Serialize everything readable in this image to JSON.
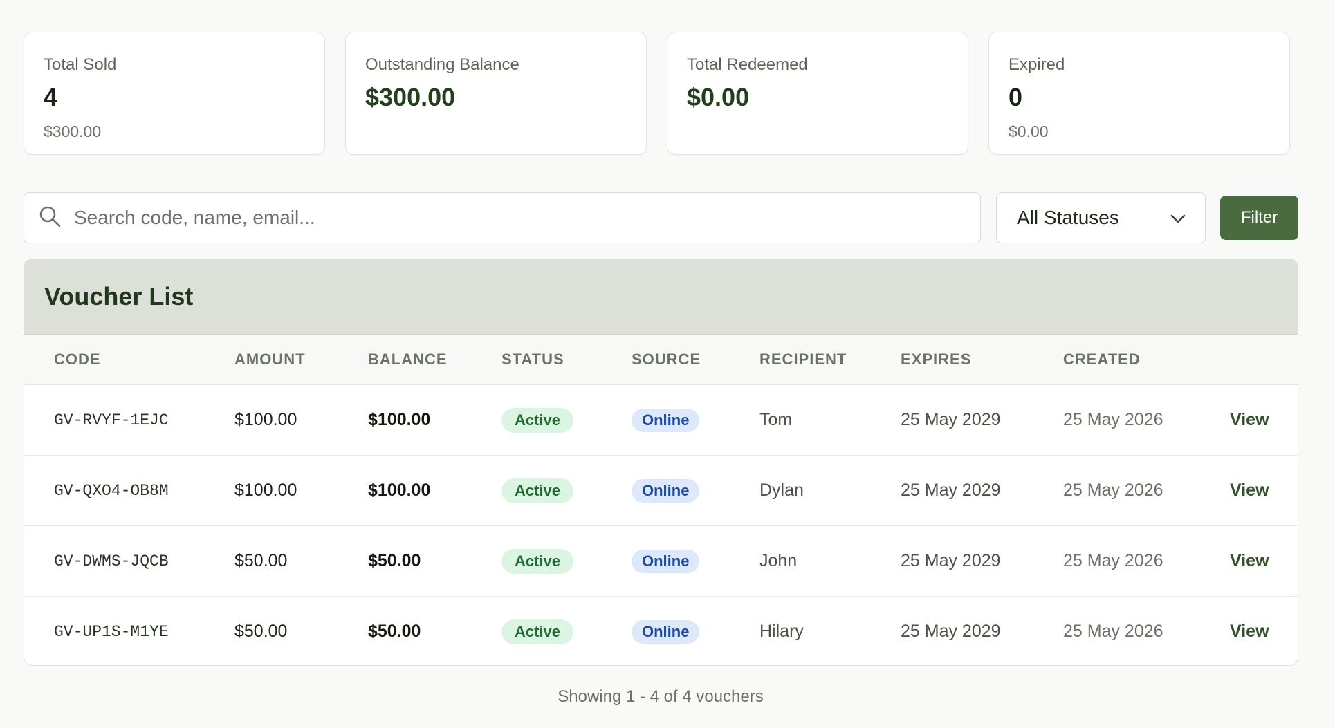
{
  "stats": [
    {
      "label": "Total Sold",
      "value": "4",
      "sub": "$300.00"
    },
    {
      "label": "Outstanding Balance",
      "value": "$300.00",
      "sub": ""
    },
    {
      "label": "Total Redeemed",
      "value": "$0.00",
      "sub": ""
    },
    {
      "label": "Expired",
      "value": "0",
      "sub": "$0.00"
    }
  ],
  "search": {
    "placeholder": "Search code, name, email...",
    "value": ""
  },
  "status_filter": {
    "selected": "All Statuses"
  },
  "filter_button": {
    "label": "Filter"
  },
  "panel": {
    "title": "Voucher List"
  },
  "table": {
    "columns": [
      "CODE",
      "AMOUNT",
      "BALANCE",
      "STATUS",
      "SOURCE",
      "RECIPIENT",
      "EXPIRES",
      "CREATED"
    ],
    "rows": [
      {
        "code": "GV-RVYF-1EJC",
        "amount": "$100.00",
        "balance": "$100.00",
        "status": "Active",
        "source": "Online",
        "recipient": "Tom",
        "expires": "25 May 2029",
        "created": "25 May 2026",
        "action": "View"
      },
      {
        "code": "GV-QXO4-OB8M",
        "amount": "$100.00",
        "balance": "$100.00",
        "status": "Active",
        "source": "Online",
        "recipient": "Dylan",
        "expires": "25 May 2029",
        "created": "25 May 2026",
        "action": "View"
      },
      {
        "code": "GV-DWMS-JQCB",
        "amount": "$50.00",
        "balance": "$50.00",
        "status": "Active",
        "source": "Online",
        "recipient": "John",
        "expires": "25 May 2029",
        "created": "25 May 2026",
        "action": "View"
      },
      {
        "code": "GV-UP1S-M1YE",
        "amount": "$50.00",
        "balance": "$50.00",
        "status": "Active",
        "source": "Online",
        "recipient": "Hilary",
        "expires": "25 May 2029",
        "created": "25 May 2026",
        "action": "View"
      }
    ]
  },
  "footer": {
    "text": "Showing 1 - 4 of 4 vouchers"
  },
  "icons": {
    "search": "search-icon",
    "dropdown": "chevron-down-icon"
  },
  "colors": {
    "accent": "#4a6a3f",
    "panel_header": "#dce0d9",
    "active_badge": "#dcf4e2",
    "online_badge": "#dde9fb"
  }
}
